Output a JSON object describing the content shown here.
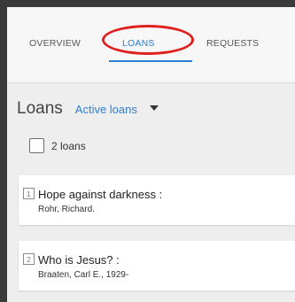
{
  "tabs": {
    "overview": "OVERVIEW",
    "loans": "LOANS",
    "requests": "REQUESTS"
  },
  "loans_header": {
    "title": "Loans",
    "filter": "Active loans"
  },
  "select_all": {
    "label": "2 loans"
  },
  "loans": [
    {
      "index": "1",
      "title": "Hope against darkness :",
      "author": "Rohr, Richard."
    },
    {
      "index": "2",
      "title": "Who is Jesus? :",
      "author": "Braaten, Carl E., 1929-"
    }
  ],
  "colors": {
    "accent": "#2f7fd1",
    "annotation_ring": "#e0201e"
  }
}
